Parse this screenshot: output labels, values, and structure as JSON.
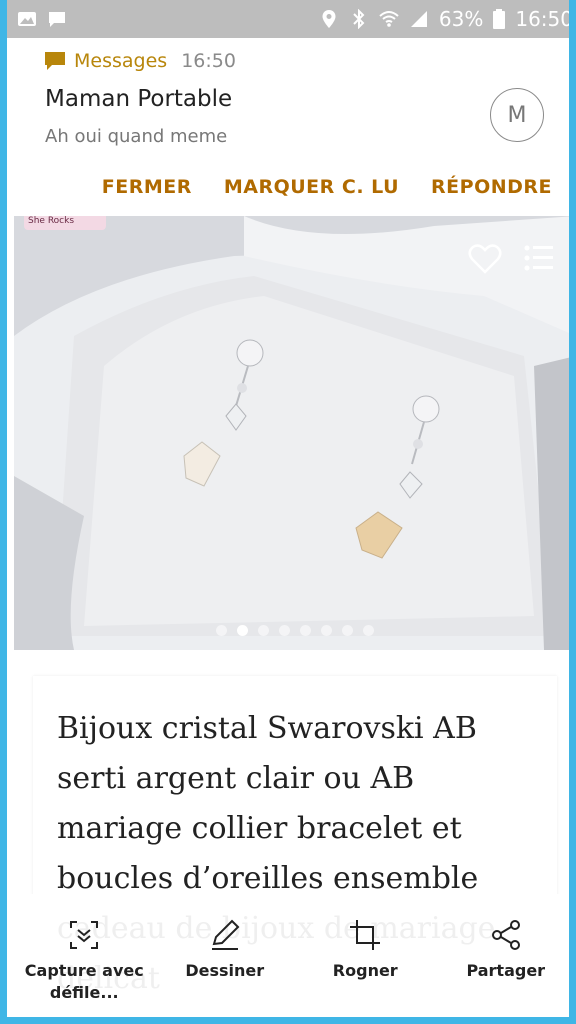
{
  "status_bar": {
    "battery": "63%",
    "time": "16:50",
    "icons": [
      "image-icon",
      "message-icon",
      "location-icon",
      "bluetooth-icon",
      "wifi-icon",
      "signal-icon",
      "battery-icon"
    ]
  },
  "notification": {
    "app_name": "Messages",
    "time": "16:50",
    "sender": "Maman Portable",
    "preview": "Ah oui quand meme",
    "avatar_letter": "M",
    "actions": [
      "FERMER",
      "MARQUER C. LU",
      "RÉPONDRE"
    ],
    "accent_color": "#b06a00"
  },
  "product": {
    "badge": "She Rocks",
    "title": "Bijoux cristal Swarovski AB serti argent clair ou AB mariage collier bracelet et boucles d’oreilles ensemble cadeau de bijoux de mariage delicat",
    "image_dots_count": 8,
    "active_dot_index": 1
  },
  "bottom_bar": {
    "items": [
      {
        "label": "Capture avec défile...",
        "icon": "scroll-capture-icon"
      },
      {
        "label": "Dessiner",
        "icon": "pen-icon"
      },
      {
        "label": "Rogner",
        "icon": "crop-icon"
      },
      {
        "label": "Partager",
        "icon": "share-icon"
      }
    ]
  },
  "colors": {
    "frame": "#3fb6e6",
    "status_bar": "#bdbdbd",
    "app_name": "#b8860b"
  }
}
